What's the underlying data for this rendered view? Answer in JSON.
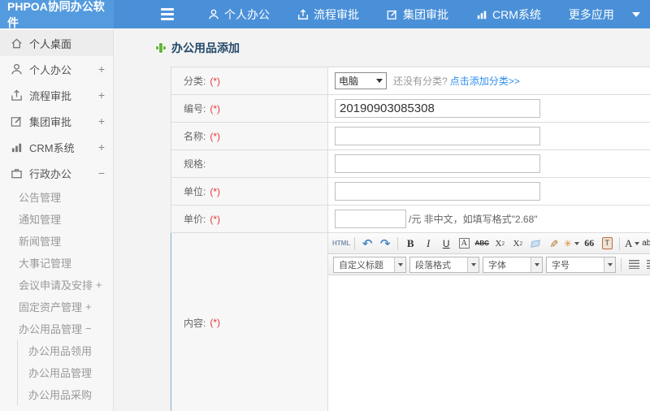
{
  "header": {
    "logo": "PHPOA协同办公软件",
    "nav": [
      {
        "label": "个人办公"
      },
      {
        "label": "流程审批"
      },
      {
        "label": "集团审批"
      },
      {
        "label": "CRM系统"
      },
      {
        "label": "更多应用"
      }
    ]
  },
  "sidebar": {
    "items": [
      {
        "label": "个人桌面",
        "toggle": ""
      },
      {
        "label": "个人办公",
        "toggle": "+"
      },
      {
        "label": "流程审批",
        "toggle": "+"
      },
      {
        "label": "集团审批",
        "toggle": "+"
      },
      {
        "label": "CRM系统",
        "toggle": "+"
      },
      {
        "label": "行政办公",
        "toggle": "−"
      }
    ],
    "admin_children": [
      {
        "label": "公告管理",
        "suffix": ""
      },
      {
        "label": "通知管理",
        "suffix": ""
      },
      {
        "label": "新闻管理",
        "suffix": ""
      },
      {
        "label": "大事记管理",
        "suffix": ""
      },
      {
        "label": "会议申请及安排",
        "suffix": "+"
      },
      {
        "label": "固定资产管理",
        "suffix": "+"
      },
      {
        "label": "办公用品管理",
        "suffix": "−"
      }
    ],
    "supplies_children": [
      {
        "label": "办公用品领用"
      },
      {
        "label": "办公用品管理"
      },
      {
        "label": "办公用品采购"
      }
    ]
  },
  "main": {
    "title": "办公用品添加",
    "form": {
      "category_label": "分类:",
      "category_required": "(*)",
      "category_value": "电脑",
      "category_hint": "还没有分类?",
      "category_link": "点击添加分类>>",
      "number_label": "编号:",
      "number_required": "(*)",
      "number_value": "20190903085308",
      "name_label": "名称:",
      "name_required": "(*)",
      "name_value": "",
      "spec_label": "规格:",
      "spec_value": "",
      "unit_label": "单位:",
      "unit_required": "(*)",
      "unit_value": "",
      "price_label": "单价:",
      "price_required": "(*)",
      "price_value": "",
      "price_suffix": "/元 非中文，如填写格式\"2.68\"",
      "content_label": "内容:",
      "content_required": "(*)"
    },
    "editor": {
      "html_btn": "HTML",
      "undo": "↶",
      "redo": "↷",
      "bold": "B",
      "italic": "I",
      "underline": "U",
      "char_border": "A",
      "strike": "ABC",
      "sup_base": "X",
      "sup_mark": "2",
      "sub_base": "X",
      "sub_mark": "2",
      "autoformat": "✳",
      "quote": "66",
      "paste_text": "T",
      "font_color": "A",
      "highlight": "ab",
      "heading_select": "自定义标题",
      "paragraph_select": "段落格式",
      "font_select": "字体",
      "size_select": "字号"
    }
  },
  "colors": {
    "header_blue": "#4a90d8",
    "logo_blue": "#549ade",
    "link_blue": "#2e8ded",
    "title_navy": "#25486b",
    "required_red": "#e4393c",
    "plus_green": "#67b440"
  }
}
